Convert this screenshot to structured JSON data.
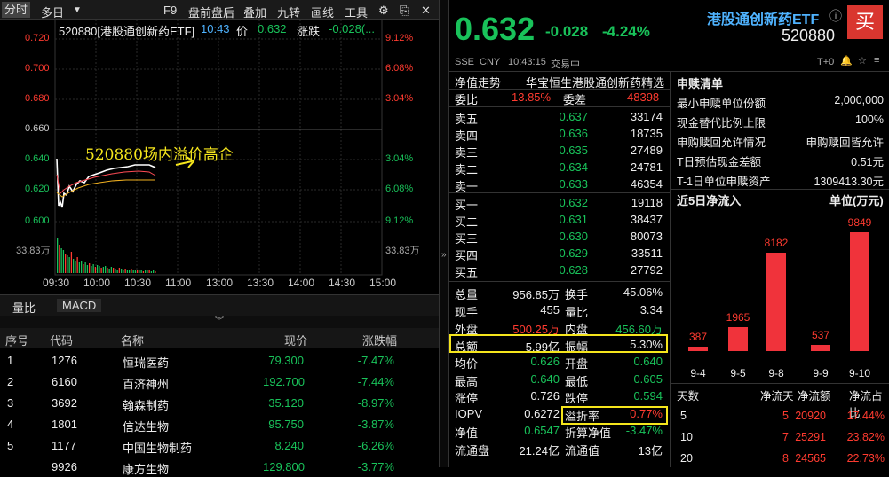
{
  "toolbar": {
    "tab_time": "分时",
    "tab_multi": "多日",
    "btn_f9": "F9",
    "btn_after": "盘前盘后",
    "btn_overlay": "叠加",
    "btn_nine": "九转",
    "btn_draw": "画线",
    "btn_tools": "工具"
  },
  "chart_header": {
    "code_name": "520880[港股通创新药ETF]",
    "time": "10:43",
    "price_label": "价",
    "price": "0.632",
    "change_label": "涨跌",
    "change": "-0.028(..."
  },
  "y_left": [
    "0.720",
    "0.700",
    "0.680",
    "0.660",
    "0.640",
    "0.620",
    "0.600"
  ],
  "y_right": [
    "9.12%",
    "6.08%",
    "3.04%",
    "",
    "3.04%",
    "6.08%",
    "9.12%"
  ],
  "vol_label": "33.83万",
  "x_ticks": [
    "09:30",
    "10:00",
    "10:30",
    "11:00",
    "13:00",
    "13:30",
    "14:00",
    "14:30",
    "15:00"
  ],
  "annotation": "520880场内溢价高企",
  "subtabs": {
    "a": "量比",
    "b": "MACD"
  },
  "table": {
    "headers": [
      "序号",
      "代码",
      "名称",
      "现价",
      "涨跌幅"
    ],
    "rows": [
      [
        "1",
        "1276",
        "恒瑞医药",
        "79.300",
        "-7.47%"
      ],
      [
        "2",
        "6160",
        "百济神州",
        "192.700",
        "-7.44%"
      ],
      [
        "3",
        "3692",
        "翰森制药",
        "35.120",
        "-8.97%"
      ],
      [
        "4",
        "1801",
        "信达生物",
        "95.750",
        "-3.87%"
      ],
      [
        "5",
        "1177",
        "中国生物制药",
        "8.240",
        "-6.26%"
      ],
      [
        "",
        "9926",
        "康方生物",
        "129.800",
        "-3.77%"
      ]
    ]
  },
  "quote": {
    "price": "0.632",
    "change": "-0.028",
    "pct": "-4.24%",
    "name": "港股通创新药ETF",
    "code": "520880",
    "buy": "买",
    "market": "SSE",
    "currency": "CNY",
    "time": "10:43:15",
    "status": "交易中",
    "t0": "T+0"
  },
  "nav_title": "净值走势",
  "index_name": "华宝恒生港股通创新药精选",
  "ratio": {
    "l1": "委比",
    "v1": "13.85%",
    "l2": "委差",
    "v2": "48398"
  },
  "asks": [
    [
      "卖五",
      "0.637",
      "33174"
    ],
    [
      "卖四",
      "0.636",
      "18735"
    ],
    [
      "卖三",
      "0.635",
      "27489"
    ],
    [
      "卖二",
      "0.634",
      "24781"
    ],
    [
      "卖一",
      "0.633",
      "46354"
    ]
  ],
  "bids": [
    [
      "买一",
      "0.632",
      "19118"
    ],
    [
      "买二",
      "0.631",
      "38437"
    ],
    [
      "买三",
      "0.630",
      "80073"
    ],
    [
      "买四",
      "0.629",
      "33511"
    ],
    [
      "买五",
      "0.628",
      "27792"
    ]
  ],
  "stats": [
    [
      "总量",
      "956.85万",
      "换手",
      "45.06%"
    ],
    [
      "现手",
      "455",
      "量比",
      "3.34"
    ],
    [
      "外盘",
      "500.25万",
      "内盘",
      "456.60万"
    ],
    [
      "总额",
      "5.99亿",
      "振幅",
      "5.30%"
    ],
    [
      "均价",
      "0.626",
      "开盘",
      "0.640"
    ],
    [
      "最高",
      "0.640",
      "最低",
      "0.605"
    ],
    [
      "涨停",
      "0.726",
      "跌停",
      "0.594"
    ],
    [
      "IOPV",
      "0.6272",
      "溢折率",
      "0.77%"
    ],
    [
      "净值",
      "0.6547",
      "折算净值",
      "-3.47%"
    ],
    [
      "流通盘",
      "21.24亿",
      "流通值",
      "13亿"
    ]
  ],
  "redemption": {
    "title": "申赎清单",
    "rows": [
      [
        "最小申赎单位份额",
        "2,000,000"
      ],
      [
        "现金替代比例上限",
        "100%"
      ],
      [
        "申购赎回允许情况",
        "申购赎回皆允许"
      ],
      [
        "T日预估现金差额",
        "0.51元"
      ],
      [
        "T-1日单位申赎资产",
        "1309413.30元"
      ]
    ]
  },
  "flow": {
    "title": "近5日净流入",
    "unit": "单位(万元)",
    "dates": [
      "9-4",
      "9-5",
      "9-8",
      "9-9",
      "9-10"
    ],
    "values": [
      387,
      1965,
      8182,
      537,
      9849
    ],
    "table_headers": [
      "天数",
      "净流天",
      "净流额",
      "净流占比"
    ],
    "table_rows": [
      [
        "5",
        "5",
        "20920",
        "17.44%"
      ],
      [
        "10",
        "7",
        "25291",
        "23.82%"
      ],
      [
        "20",
        "8",
        "24565",
        "22.73%"
      ]
    ]
  },
  "colors": {
    "up": "#ff3b30",
    "down": "#19c25a",
    "highlight": "#f5e51c"
  }
}
